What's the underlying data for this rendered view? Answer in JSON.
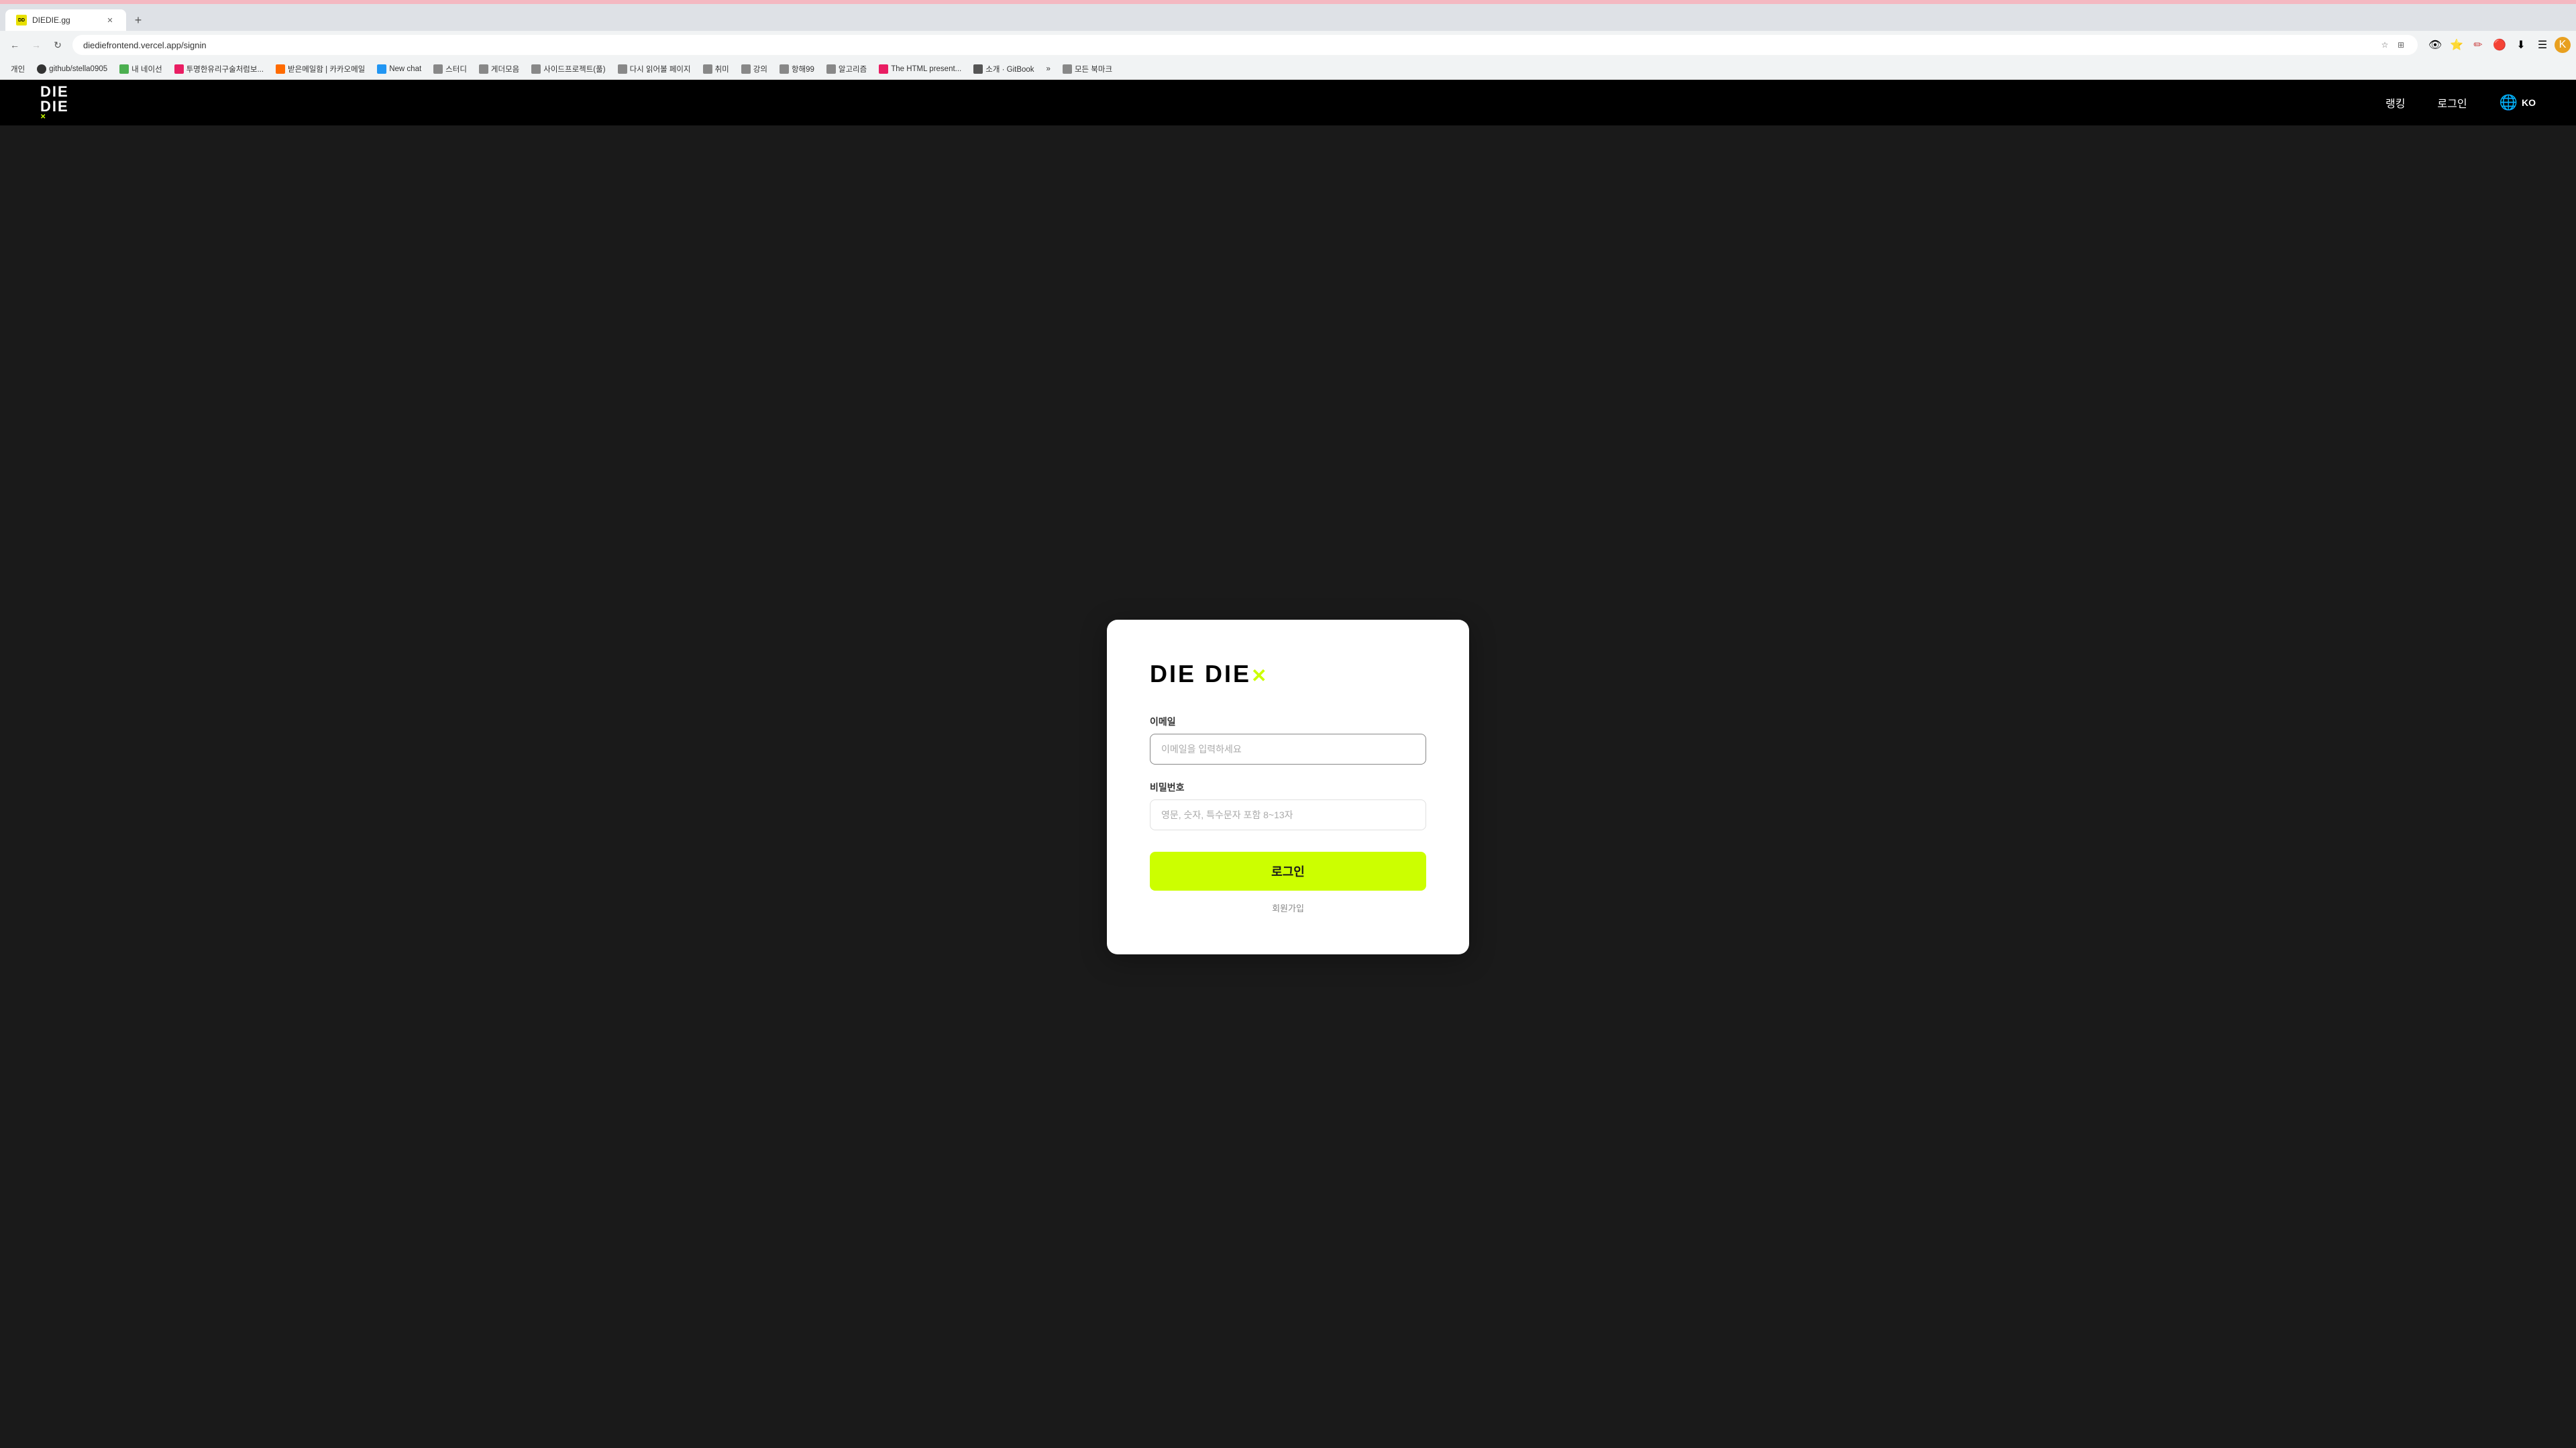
{
  "browser": {
    "tab": {
      "title": "DIEDIE.gg",
      "favicon": "DD",
      "url": "diediefrontend.vercel.app/signin"
    },
    "new_tab_label": "+",
    "nav": {
      "back_disabled": false,
      "forward_disabled": true,
      "reload_label": "↻",
      "home_label": "⌂"
    },
    "address": "diediefrontend.vercel.app/signin",
    "bookmarks": [
      {
        "label": "개인",
        "favicon_bg": "#f0f0f0"
      },
      {
        "label": "github/stella0905",
        "favicon_color": "#333",
        "favicon_bg": "#f0f0f0"
      },
      {
        "label": "내 네이선",
        "favicon_color": "#4CAF50",
        "favicon_bg": "#e8f5e9"
      },
      {
        "label": "투명한유리구술처럼보...",
        "favicon_color": "#e91e63",
        "favicon_bg": "#fce4ec"
      },
      {
        "label": "받은메일함 | 카카오메일",
        "favicon_color": "#ff6b00",
        "favicon_bg": "#fff3e0"
      },
      {
        "label": "New chat",
        "favicon_color": "#2196F3",
        "favicon_bg": "#e3f2fd"
      },
      {
        "label": "스터디",
        "favicon_color": "#555",
        "favicon_bg": "#f5f5f5"
      },
      {
        "label": "게더모음",
        "favicon_color": "#555",
        "favicon_bg": "#f5f5f5"
      },
      {
        "label": "사이드프로젝트(풀)",
        "favicon_color": "#555",
        "favicon_bg": "#f5f5f5"
      },
      {
        "label": "다시 읽어볼 페이지",
        "favicon_color": "#555",
        "favicon_bg": "#f5f5f5"
      },
      {
        "label": "취미",
        "favicon_color": "#555",
        "favicon_bg": "#f5f5f5"
      },
      {
        "label": "강의",
        "favicon_color": "#555",
        "favicon_bg": "#f5f5f5"
      },
      {
        "label": "항해99",
        "favicon_color": "#555",
        "favicon_bg": "#f5f5f5"
      },
      {
        "label": "알고리즘",
        "favicon_color": "#555",
        "favicon_bg": "#f5f5f5"
      },
      {
        "label": "The HTML present...",
        "favicon_color": "#e91e63",
        "favicon_bg": "#fce4ec"
      },
      {
        "label": "소개 · GitBook",
        "favicon_color": "#555",
        "favicon_bg": "#f5f5f5"
      },
      {
        "label": "»",
        "favicon_color": "#555",
        "favicon_bg": "#f5f5f5"
      },
      {
        "label": "모든 북마크",
        "favicon_color": "#555",
        "favicon_bg": "#f5f5f5"
      }
    ]
  },
  "header": {
    "logo_line1": "DIE",
    "logo_line2": "DIE",
    "logo_x": "✕",
    "nav_ranking": "랭킹",
    "nav_login": "로그인",
    "lang_code": "KO"
  },
  "login_card": {
    "logo_text": "DIE DIE",
    "logo_x": "✕",
    "email_label": "이메일",
    "email_placeholder": "이메일을 입력하세요",
    "password_label": "비밀번호",
    "password_placeholder": "영문, 숫자, 특수문자 포함 8~13자",
    "login_button": "로그인",
    "register_link": "회원가입"
  },
  "colors": {
    "accent": "#ccff00",
    "background": "#1a1a1a",
    "header_bg": "#000000",
    "card_bg": "#ffffff",
    "tab_bar_top": "#f4b8c1"
  }
}
